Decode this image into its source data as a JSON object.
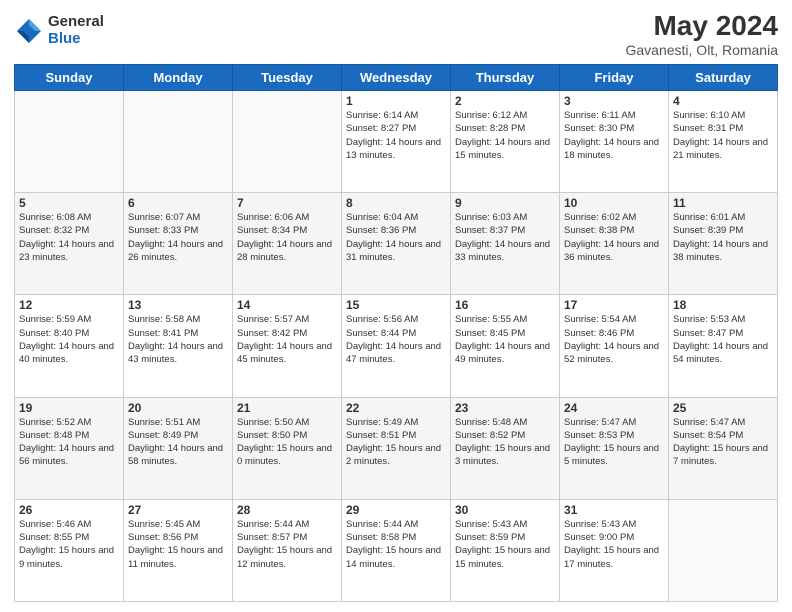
{
  "logo": {
    "general": "General",
    "blue": "Blue"
  },
  "title": "May 2024",
  "subtitle": "Gavanesti, Olt, Romania",
  "days_of_week": [
    "Sunday",
    "Monday",
    "Tuesday",
    "Wednesday",
    "Thursday",
    "Friday",
    "Saturday"
  ],
  "weeks": [
    [
      {
        "day": "",
        "info": ""
      },
      {
        "day": "",
        "info": ""
      },
      {
        "day": "",
        "info": ""
      },
      {
        "day": "1",
        "info": "Sunrise: 6:14 AM\nSunset: 8:27 PM\nDaylight: 14 hours and 13 minutes."
      },
      {
        "day": "2",
        "info": "Sunrise: 6:12 AM\nSunset: 8:28 PM\nDaylight: 14 hours and 15 minutes."
      },
      {
        "day": "3",
        "info": "Sunrise: 6:11 AM\nSunset: 8:30 PM\nDaylight: 14 hours and 18 minutes."
      },
      {
        "day": "4",
        "info": "Sunrise: 6:10 AM\nSunset: 8:31 PM\nDaylight: 14 hours and 21 minutes."
      }
    ],
    [
      {
        "day": "5",
        "info": "Sunrise: 6:08 AM\nSunset: 8:32 PM\nDaylight: 14 hours and 23 minutes."
      },
      {
        "day": "6",
        "info": "Sunrise: 6:07 AM\nSunset: 8:33 PM\nDaylight: 14 hours and 26 minutes."
      },
      {
        "day": "7",
        "info": "Sunrise: 6:06 AM\nSunset: 8:34 PM\nDaylight: 14 hours and 28 minutes."
      },
      {
        "day": "8",
        "info": "Sunrise: 6:04 AM\nSunset: 8:36 PM\nDaylight: 14 hours and 31 minutes."
      },
      {
        "day": "9",
        "info": "Sunrise: 6:03 AM\nSunset: 8:37 PM\nDaylight: 14 hours and 33 minutes."
      },
      {
        "day": "10",
        "info": "Sunrise: 6:02 AM\nSunset: 8:38 PM\nDaylight: 14 hours and 36 minutes."
      },
      {
        "day": "11",
        "info": "Sunrise: 6:01 AM\nSunset: 8:39 PM\nDaylight: 14 hours and 38 minutes."
      }
    ],
    [
      {
        "day": "12",
        "info": "Sunrise: 5:59 AM\nSunset: 8:40 PM\nDaylight: 14 hours and 40 minutes."
      },
      {
        "day": "13",
        "info": "Sunrise: 5:58 AM\nSunset: 8:41 PM\nDaylight: 14 hours and 43 minutes."
      },
      {
        "day": "14",
        "info": "Sunrise: 5:57 AM\nSunset: 8:42 PM\nDaylight: 14 hours and 45 minutes."
      },
      {
        "day": "15",
        "info": "Sunrise: 5:56 AM\nSunset: 8:44 PM\nDaylight: 14 hours and 47 minutes."
      },
      {
        "day": "16",
        "info": "Sunrise: 5:55 AM\nSunset: 8:45 PM\nDaylight: 14 hours and 49 minutes."
      },
      {
        "day": "17",
        "info": "Sunrise: 5:54 AM\nSunset: 8:46 PM\nDaylight: 14 hours and 52 minutes."
      },
      {
        "day": "18",
        "info": "Sunrise: 5:53 AM\nSunset: 8:47 PM\nDaylight: 14 hours and 54 minutes."
      }
    ],
    [
      {
        "day": "19",
        "info": "Sunrise: 5:52 AM\nSunset: 8:48 PM\nDaylight: 14 hours and 56 minutes."
      },
      {
        "day": "20",
        "info": "Sunrise: 5:51 AM\nSunset: 8:49 PM\nDaylight: 14 hours and 58 minutes."
      },
      {
        "day": "21",
        "info": "Sunrise: 5:50 AM\nSunset: 8:50 PM\nDaylight: 15 hours and 0 minutes."
      },
      {
        "day": "22",
        "info": "Sunrise: 5:49 AM\nSunset: 8:51 PM\nDaylight: 15 hours and 2 minutes."
      },
      {
        "day": "23",
        "info": "Sunrise: 5:48 AM\nSunset: 8:52 PM\nDaylight: 15 hours and 3 minutes."
      },
      {
        "day": "24",
        "info": "Sunrise: 5:47 AM\nSunset: 8:53 PM\nDaylight: 15 hours and 5 minutes."
      },
      {
        "day": "25",
        "info": "Sunrise: 5:47 AM\nSunset: 8:54 PM\nDaylight: 15 hours and 7 minutes."
      }
    ],
    [
      {
        "day": "26",
        "info": "Sunrise: 5:46 AM\nSunset: 8:55 PM\nDaylight: 15 hours and 9 minutes."
      },
      {
        "day": "27",
        "info": "Sunrise: 5:45 AM\nSunset: 8:56 PM\nDaylight: 15 hours and 11 minutes."
      },
      {
        "day": "28",
        "info": "Sunrise: 5:44 AM\nSunset: 8:57 PM\nDaylight: 15 hours and 12 minutes."
      },
      {
        "day": "29",
        "info": "Sunrise: 5:44 AM\nSunset: 8:58 PM\nDaylight: 15 hours and 14 minutes."
      },
      {
        "day": "30",
        "info": "Sunrise: 5:43 AM\nSunset: 8:59 PM\nDaylight: 15 hours and 15 minutes."
      },
      {
        "day": "31",
        "info": "Sunrise: 5:43 AM\nSunset: 9:00 PM\nDaylight: 15 hours and 17 minutes."
      },
      {
        "day": "",
        "info": ""
      }
    ]
  ]
}
